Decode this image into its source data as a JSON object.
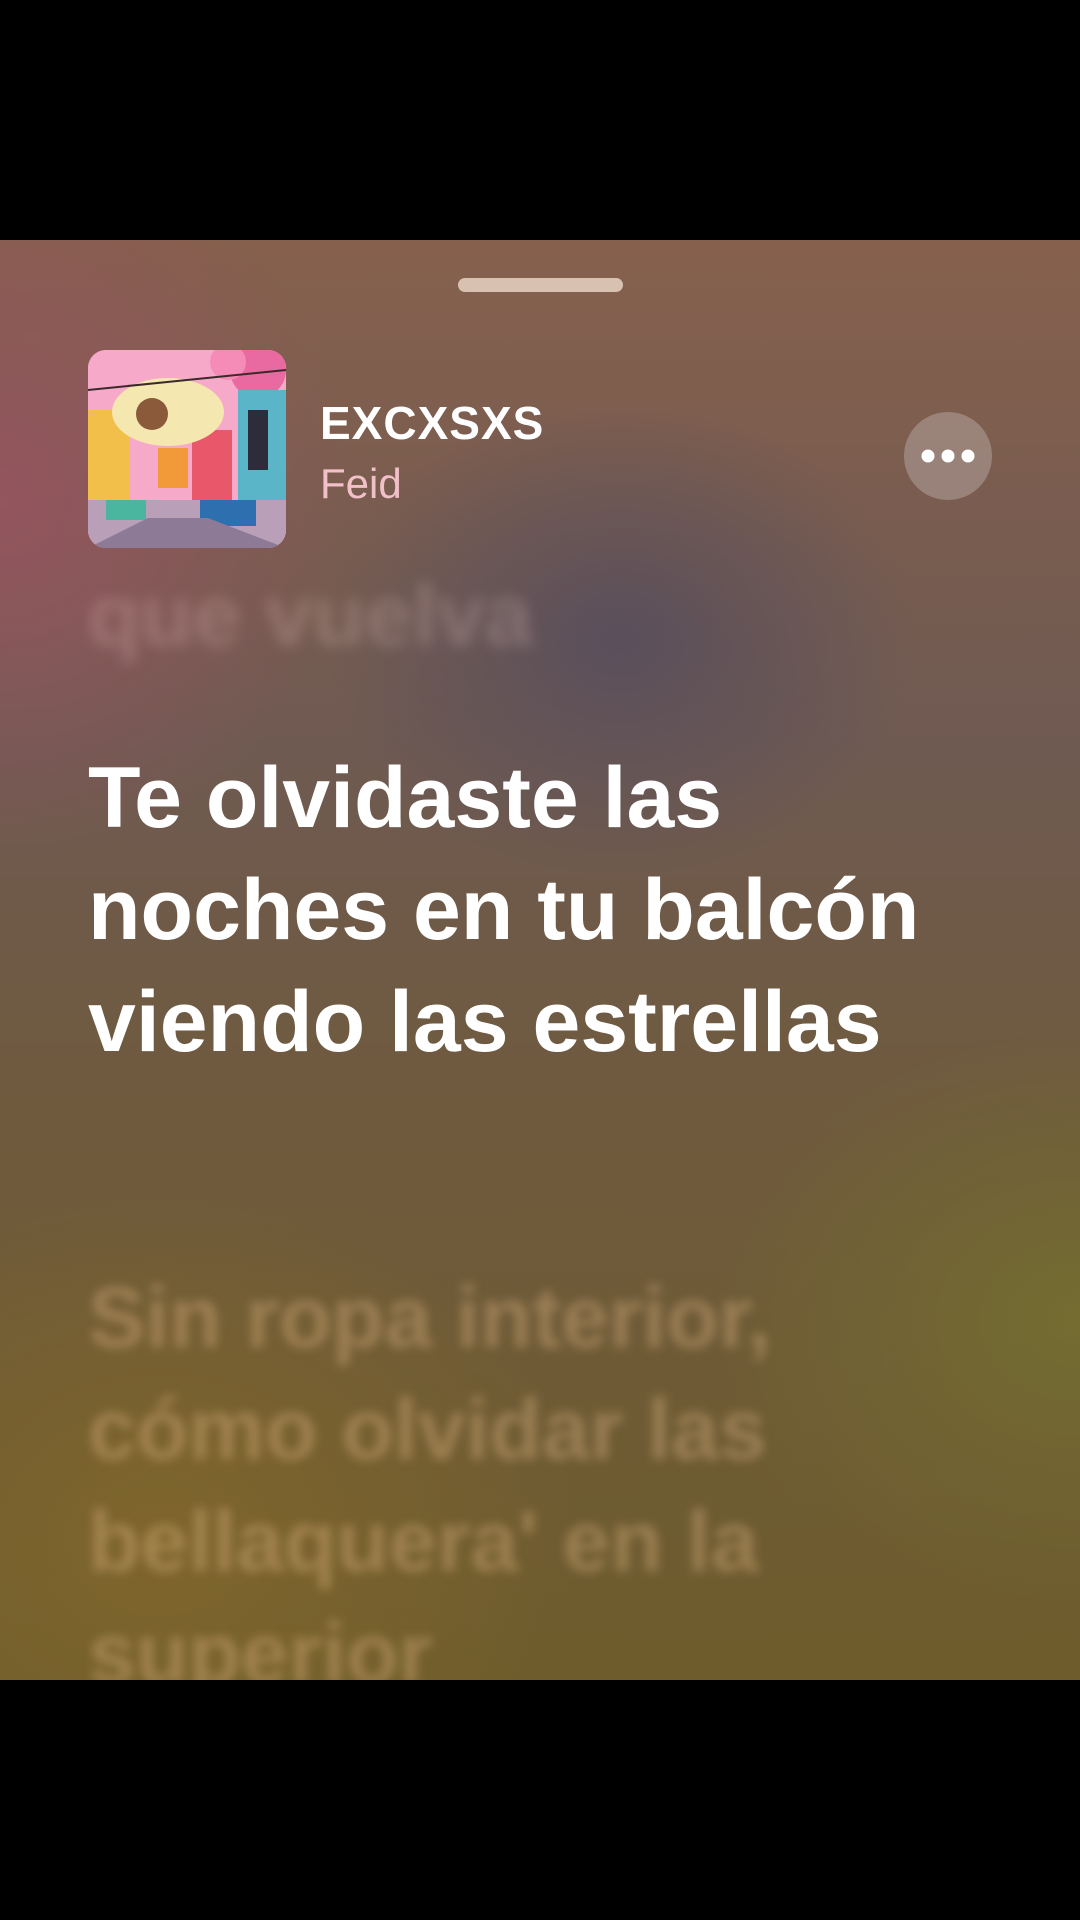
{
  "now_playing": {
    "title": "EXCXSXS",
    "artist": "Feid",
    "artwork_icon": "album-artwork"
  },
  "controls": {
    "more_icon": "ellipsis-icon",
    "grabber_icon": "sheet-grabber"
  },
  "lyrics": {
    "previous": "que vuelva",
    "current": "Te olvidaste las noches en tu balcón viendo las estrellas",
    "next": "Sin ropa interior, cómo olvidar las bellaquera' en la superior"
  },
  "colors": {
    "current_lyric": "#ffffff",
    "artist": "#f2c0c8",
    "background_top": "#86604d",
    "background_bottom": "#6e5c2c"
  }
}
